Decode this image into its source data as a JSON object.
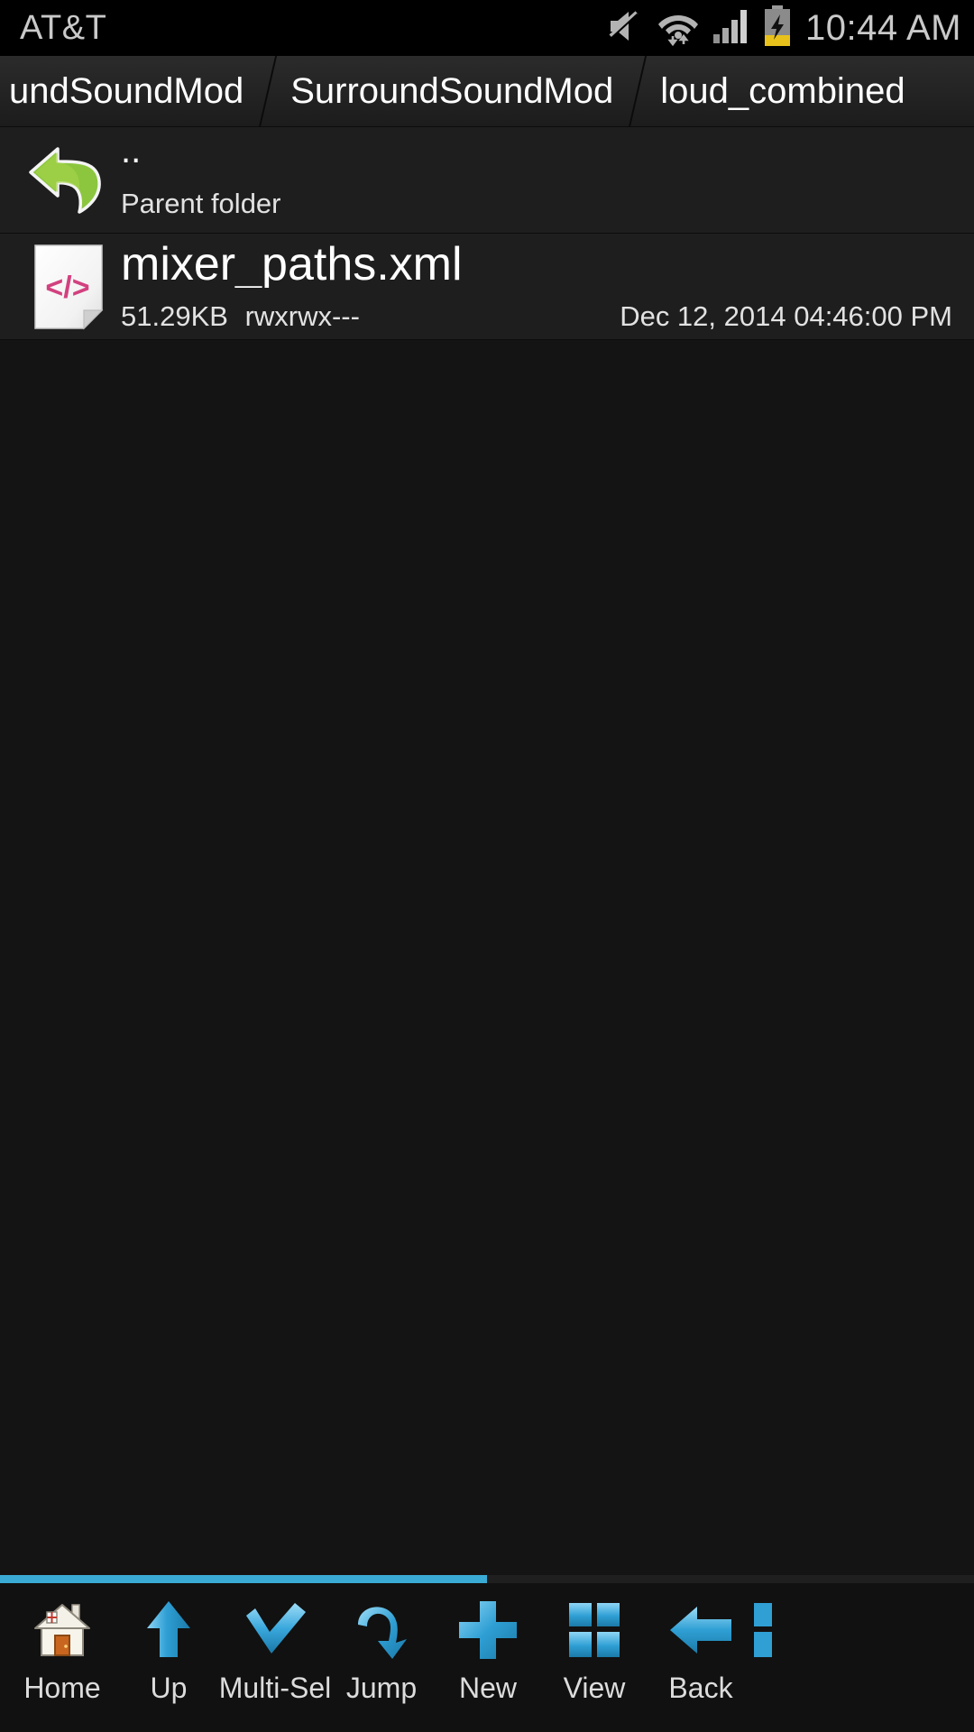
{
  "status_bar": {
    "carrier": "AT&T",
    "clock": "10:44 AM",
    "icons": [
      "mute-icon",
      "wifi-icon",
      "cellular-signal-icon",
      "battery-charging-icon"
    ],
    "battery_fill_color": "#e8c21a",
    "icon_color": "#b3b3b3"
  },
  "breadcrumb": {
    "items": [
      {
        "label": "undSoundMod",
        "truncated": true
      },
      {
        "label": "SurroundSoundMod",
        "truncated": false
      },
      {
        "label": "loud_combined",
        "truncated": false
      }
    ]
  },
  "file_list": {
    "parent_row": {
      "icon": "back-arrow-green-icon",
      "title": "..",
      "subtitle": "Parent folder"
    },
    "files": [
      {
        "icon": "xml-code-file-icon",
        "name": "mixer_paths.xml",
        "size": "51.29KB",
        "permissions": "rwxrwx---",
        "modified": "Dec 12, 2014 04:46:00 PM"
      }
    ]
  },
  "toolbar": {
    "scrollbar": {
      "thumb_percent": 50,
      "color": "#3aabd4"
    },
    "items": [
      {
        "label": "Home",
        "icon": "home-house-icon"
      },
      {
        "label": "Up",
        "icon": "arrow-up-icon"
      },
      {
        "label": "Multi-Sel",
        "icon": "checkmark-icon"
      },
      {
        "label": "Jump",
        "icon": "curved-arrow-jump-icon"
      },
      {
        "label": "New",
        "icon": "plus-icon"
      },
      {
        "label": "View",
        "icon": "grid-view-icon"
      },
      {
        "label": "Back",
        "icon": "arrow-left-icon"
      }
    ],
    "partial_item": {
      "icon": "grid-partial-icon"
    },
    "accent_color": "#2f9fd4"
  },
  "theme": {
    "background": "#141414",
    "row_background": "#1e1e1e",
    "text_primary": "#ffffff",
    "text_secondary": "#e2e2e2",
    "file_icon_accent": "#d2417f",
    "parent_icon_color": "#8cc63f"
  }
}
